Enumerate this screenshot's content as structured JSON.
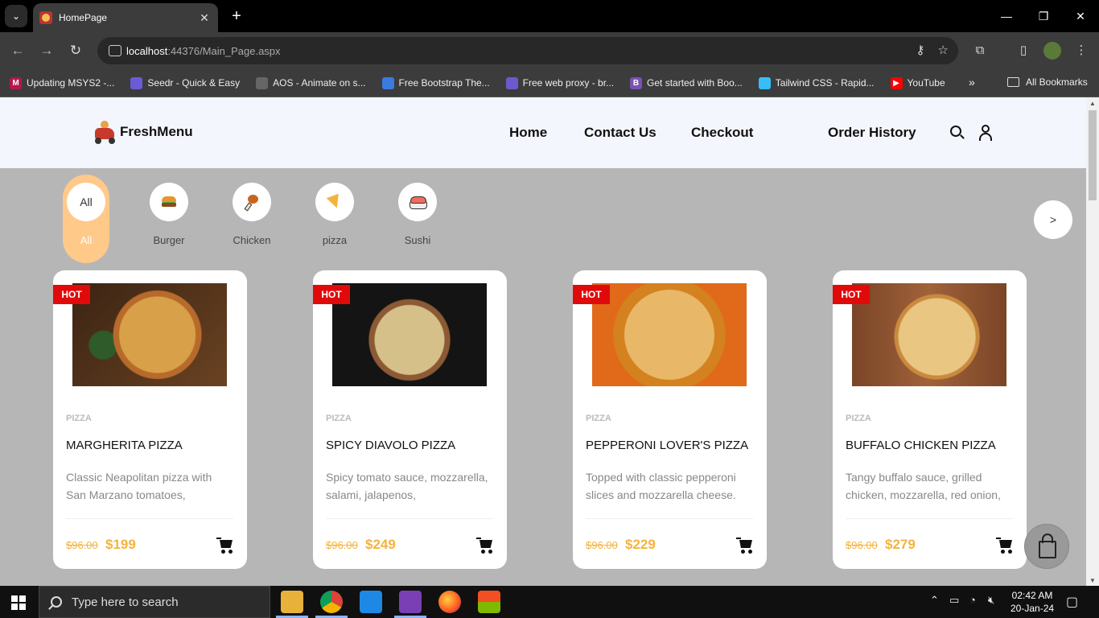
{
  "browser": {
    "tab_title": "HomePage",
    "new_tab": "+",
    "tab_close": "✕",
    "url_host": "localhost",
    "url_path": ":44376/Main_Page.aspx",
    "bookmarks": [
      {
        "label": "Updating MSYS2 -...",
        "color": "#b5174d",
        "glyph": "M"
      },
      {
        "label": "Seedr - Quick & Easy",
        "color": "#6b5bd6",
        "glyph": ""
      },
      {
        "label": "AOS - Animate on s...",
        "color": "#666666",
        "glyph": ""
      },
      {
        "label": "Free Bootstrap The...",
        "color": "#3a7be0",
        "glyph": ""
      },
      {
        "label": "Free web proxy - br...",
        "color": "#6a5acd",
        "glyph": ""
      },
      {
        "label": "Get started with Boo...",
        "color": "#7952b3",
        "glyph": "B"
      },
      {
        "label": "Tailwind CSS - Rapid...",
        "color": "#38bdf8",
        "glyph": ""
      },
      {
        "label": "YouTube",
        "color": "#ff0000",
        "glyph": "▶"
      }
    ],
    "bookmarks_more": "»",
    "all_bookmarks": "All Bookmarks"
  },
  "site": {
    "logo_text": "FreshMenu",
    "nav": {
      "home": "Home",
      "contact": "Contact Us",
      "checkout": "Checkout",
      "order_history": "Order History"
    }
  },
  "categories": [
    {
      "label": "All",
      "circle_text": "All",
      "icon": "all"
    },
    {
      "label": "Burger",
      "icon": "burger-icon"
    },
    {
      "label": "Chicken",
      "icon": "chicken-icon"
    },
    {
      "label": "pizza",
      "icon": "pizza-icon"
    },
    {
      "label": "Sushi",
      "icon": "sushi-icon"
    }
  ],
  "category_next": ">",
  "products": [
    {
      "badge": "HOT",
      "category": "PIZZA",
      "title": "MARGHERITA PIZZA",
      "description": "Classic Neapolitan pizza with San Marzano tomatoes,",
      "old_price": "$96.00",
      "price": "$199"
    },
    {
      "badge": "HOT",
      "category": "PIZZA",
      "title": "SPICY DIAVOLO PIZZA",
      "description": "Spicy tomato sauce, mozzarella, salami, jalapenos,",
      "old_price": "$96.00",
      "price": "$249"
    },
    {
      "badge": "HOT",
      "category": "PIZZA",
      "title": "PEPPERONI LOVER'S PIZZA",
      "description": "Topped with classic pepperoni slices and mozzarella cheese.",
      "old_price": "$96.00",
      "price": "$229"
    },
    {
      "badge": "HOT",
      "category": "PIZZA",
      "title": "BUFFALO CHICKEN PIZZA",
      "description": "Tangy buffalo sauce, grilled chicken, mozzarella, red onion,",
      "old_price": "$96.00",
      "price": "$279"
    }
  ],
  "taskbar": {
    "search_placeholder": "Type here to search",
    "time": "02:42 AM",
    "date": "20-Jan-24"
  },
  "colors": {
    "accent": "#f3b33d",
    "hot_badge": "#e10a0a",
    "active_category": "#ffc989",
    "page_bg": "#b7b6b6"
  }
}
